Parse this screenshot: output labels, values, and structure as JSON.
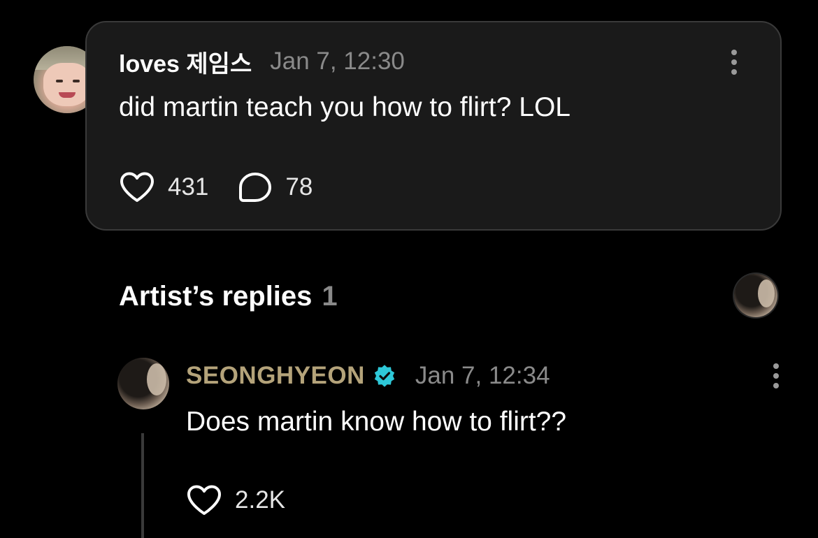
{
  "comment": {
    "username": "loves 제임스",
    "timestamp": "Jan 7, 12:30",
    "text": "did martin teach you how to flirt? LOL",
    "likes": "431",
    "replies": "78",
    "avatar_icon": "user-avatar-photo",
    "more_icon": "more-vertical-icon"
  },
  "artist_replies": {
    "title": "Artist’s replies",
    "count": "1",
    "avatar_icon": "artist-avatar-photo"
  },
  "reply": {
    "author": "SEONGHYEON",
    "verified_icon": "verified-badge-icon",
    "timestamp": "Jan 7, 12:34",
    "text": "Does martin know how to flirt??",
    "likes": "2.2K",
    "more_icon": "more-vertical-icon"
  },
  "colors": {
    "background": "#000000",
    "card": "#1a1a1a",
    "card_border": "#3a3a3a",
    "artist_name": "#b4a37a",
    "verified": "#2ec8d8",
    "muted_text": "#8a8a8a"
  }
}
